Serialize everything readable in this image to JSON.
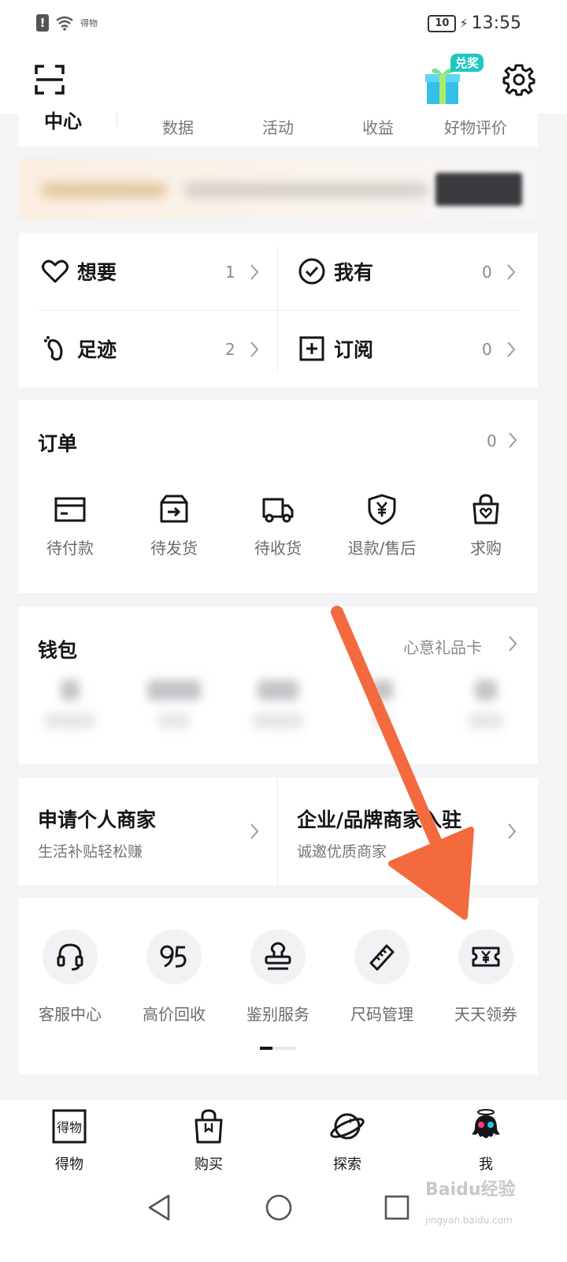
{
  "status_bar": {
    "carrier": "得物",
    "battery": "10",
    "time": "13:55"
  },
  "top_bar": {
    "gift_badge": "兑奖"
  },
  "tabs": {
    "first": "中心",
    "items": [
      "数据",
      "活动",
      "收益",
      "好物评价"
    ]
  },
  "quick_links": [
    {
      "label": "想要",
      "count": "1"
    },
    {
      "label": "我有",
      "count": "0"
    },
    {
      "label": "足迹",
      "count": "2"
    },
    {
      "label": "订阅",
      "count": "0"
    }
  ],
  "orders": {
    "title": "订单",
    "count": "0",
    "items": [
      "待付款",
      "待发货",
      "待收货",
      "退款/售后",
      "求购"
    ]
  },
  "wallet": {
    "title": "钱包",
    "link": "心意礼品卡"
  },
  "merchant": [
    {
      "title": "申请个人商家",
      "subtitle": "生活补贴轻松赚"
    },
    {
      "title": "企业/品牌商家入驻",
      "subtitle": "诚邀优质商家"
    }
  ],
  "services": [
    "客服中心",
    "高价回收",
    "鉴别服务",
    "尺码管理",
    "天天领券"
  ],
  "tab_bar": [
    "得物",
    "购买",
    "探索",
    "我"
  ],
  "watermark": {
    "main": "Baidu经验",
    "sub": "jingyan.baidu.com"
  },
  "colors": {
    "accent_arrow": "#f26a3d",
    "teal_badge": "#1ec8c0"
  }
}
